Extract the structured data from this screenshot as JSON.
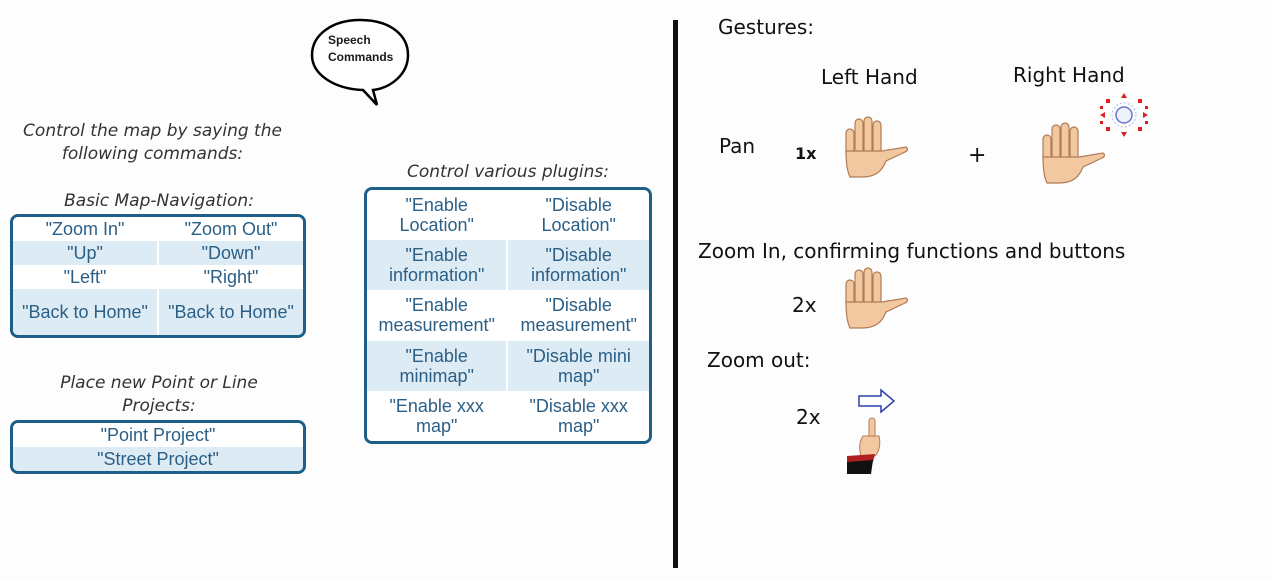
{
  "bubble": {
    "line1": "Speech",
    "line2": "Commands"
  },
  "intro": {
    "line1": "Control the map by saying the",
    "line2": "following commands:"
  },
  "navigation": {
    "heading": "Basic Map-Navigation:",
    "rows": [
      [
        "\"Zoom In\"",
        "\"Zoom Out\""
      ],
      [
        "\"Up\"",
        "\"Down\""
      ],
      [
        "\"Left\"",
        "\"Right\""
      ],
      [
        "\"Back to Home\"",
        "\"Back to Home\""
      ]
    ]
  },
  "projects": {
    "heading_line1": "Place new Point or Line",
    "heading_line2": "Projects:",
    "rows": [
      "\"Point Project\"",
      "\"Street Project\""
    ]
  },
  "plugins": {
    "heading": "Control various plugins:",
    "rows": [
      [
        "\"Enable Location\"",
        "\"Disable Location\""
      ],
      [
        "\"Enable information\"",
        "\"Disable information\""
      ],
      [
        "\"Enable measurement\"",
        "\"Disable measurement\""
      ],
      [
        "\"Enable minimap\"",
        "\"Disable mini map\""
      ],
      [
        "\"Enable xxx map\"",
        "\"Disable xxx map\""
      ]
    ]
  },
  "gestures": {
    "title": "Gestures:",
    "left_hand": "Left Hand",
    "right_hand": "Right Hand",
    "pan_label": "Pan",
    "pan_count": "1x",
    "plus": "+",
    "zoom_in_label": "Zoom In, confirming functions and buttons",
    "zoom_in_count": "2x",
    "zoom_out_label": "Zoom out:",
    "zoom_out_count": "2x"
  },
  "colors": {
    "table_border": "#1d5f86",
    "table_text": "#2b5f86",
    "table_alt_row": "#dcebf4",
    "skin": "#f2c8a0",
    "arrow_outline": "#2d3fa8",
    "pan_indicator": "#e02020"
  },
  "icons": [
    "speech-bubble",
    "open-hand-icon",
    "pan-indicator-icon",
    "pointing-hand-icon",
    "right-arrow-icon"
  ]
}
